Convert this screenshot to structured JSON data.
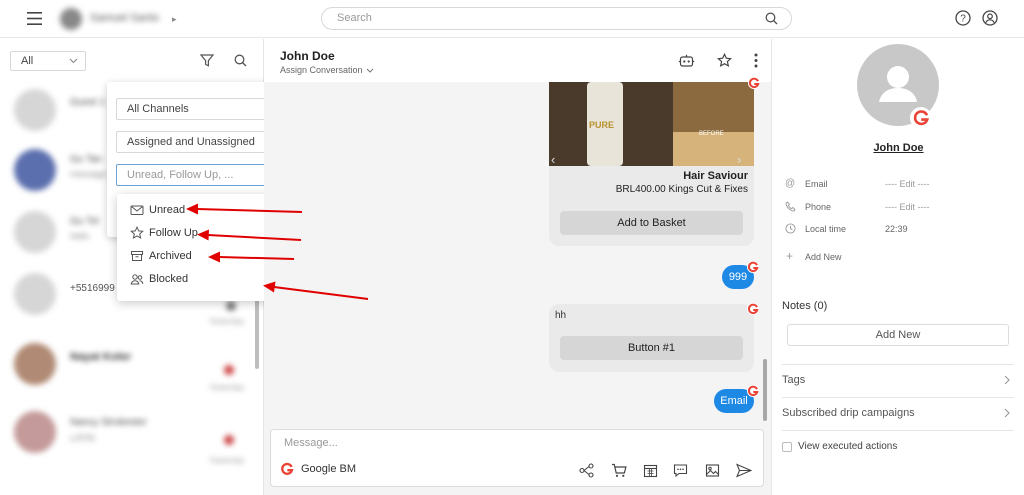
{
  "topbar": {
    "user_name": "Samuel Santo",
    "search_placeholder": "Search"
  },
  "left_pane": {
    "channel_filter": "All",
    "conversations": [
      {
        "name": "Guest 1",
        "preview": ""
      },
      {
        "name": "Gu Tan",
        "preview": "message"
      },
      {
        "name": "Gu Tol",
        "preview": "hello"
      },
      {
        "name": "+5516999",
        "preview": "",
        "time": "Yesterday"
      },
      {
        "name": "Nayat Koler",
        "preview": "",
        "time": "Yesterday"
      },
      {
        "name": "Nancy Strokester",
        "preview": "LATIN",
        "time": "Yesterday"
      }
    ]
  },
  "filter_panel": {
    "channels": "All Channels",
    "assignment": "Assigned and Unassigned",
    "status_placeholder": "Unread, Follow Up, ...",
    "options": [
      {
        "label": "Unread",
        "icon": "envelope-icon"
      },
      {
        "label": "Follow Up",
        "icon": "star-icon"
      },
      {
        "label": "Archived",
        "icon": "archive-icon"
      },
      {
        "label": "Blocked",
        "icon": "people-icon"
      }
    ]
  },
  "chat": {
    "contact_name": "John Doe",
    "assign_label": "Assign Conversation",
    "product": {
      "title": "Hair Saviour",
      "price": "BRL400.00 Kings Cut & Fixes",
      "image_caption": "BEFORE",
      "button": "Add to Basket"
    },
    "msg_999": "999",
    "msg_hh": "hh",
    "msg_button": "Button #1",
    "msg_email": "Email",
    "compose_placeholder": "Message...",
    "channel_name": "Google BM"
  },
  "contact": {
    "name": "John Doe",
    "fields": [
      {
        "label": "Email",
        "value": "---- Edit ----",
        "icon": "at-icon"
      },
      {
        "label": "Phone",
        "value": "---- Edit ----",
        "icon": "phone-icon"
      },
      {
        "label": "Local time",
        "value": "22:39",
        "icon": "clock-icon"
      }
    ],
    "add_new_field": "Add New",
    "notes_label": "Notes (0)",
    "notes_add": "Add New",
    "tags": "Tags",
    "drip": "Subscribed drip campaigns",
    "executed": "View executed actions"
  },
  "colors": {
    "accent": "#1e88e5",
    "annotation_arrow": "#e00000",
    "google_red": "#ea4335"
  }
}
